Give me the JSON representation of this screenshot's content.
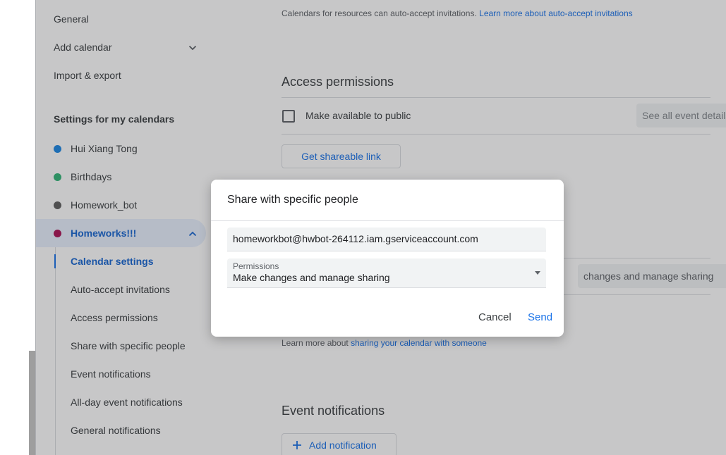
{
  "sidebar": {
    "items": [
      {
        "label": "General"
      },
      {
        "label": "Add calendar"
      },
      {
        "label": "Import & export"
      }
    ],
    "section_title": "Settings for my calendars",
    "calendars": [
      {
        "label": "Hui Xiang Tong",
        "color": "#1e88e5"
      },
      {
        "label": "Birthdays",
        "color": "#33b679"
      },
      {
        "label": "Homework_bot",
        "color": "#616161"
      },
      {
        "label": "Homeworks!!!",
        "color": "#ad1457"
      }
    ],
    "sub_items": [
      {
        "label": "Calendar settings"
      },
      {
        "label": "Auto-accept invitations"
      },
      {
        "label": "Access permissions"
      },
      {
        "label": "Share with specific people"
      },
      {
        "label": "Event notifications"
      },
      {
        "label": "All-day event notifications"
      },
      {
        "label": "General notifications"
      }
    ]
  },
  "main": {
    "auto_accept_text": "Calendars for resources can auto-accept invitations.",
    "auto_accept_link": "Learn more about auto-accept invitations",
    "access_title": "Access permissions",
    "make_public_label": "Make available to public",
    "event_details_select": "See all event details",
    "shareable_link_button": "Get shareable link",
    "share_select_partial": "changes and manage sharing",
    "learn_more_prefix": "Learn more about",
    "learn_more_link": "sharing your calendar with someone",
    "event_notifications_title": "Event notifications",
    "add_notification_button": "Add notification"
  },
  "dialog": {
    "title": "Share with specific people",
    "email_value": "homeworkbot@hwbot-264112.iam.gserviceaccount.com",
    "permissions_label": "Permissions",
    "permissions_value": "Make changes and manage sharing",
    "cancel_label": "Cancel",
    "send_label": "Send"
  }
}
